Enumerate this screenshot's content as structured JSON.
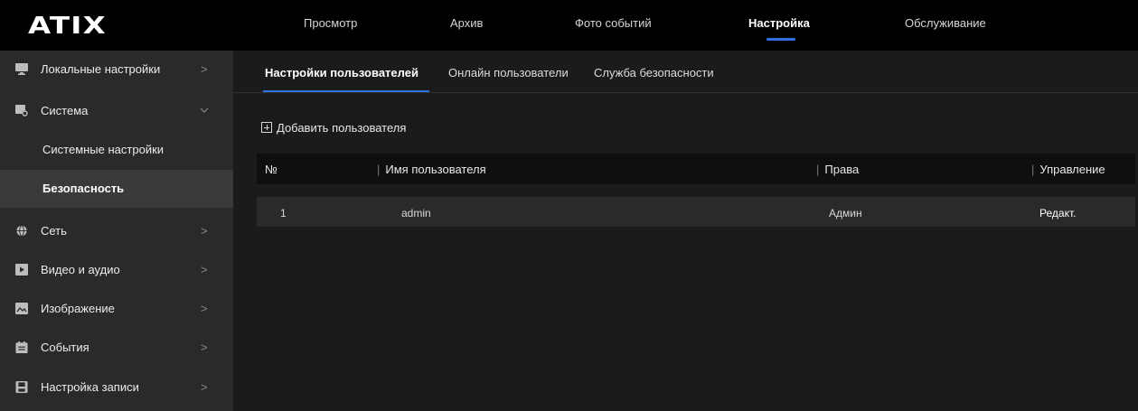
{
  "header": {
    "logo": "ATIX",
    "nav": [
      {
        "label": "Просмотр"
      },
      {
        "label": "Архив"
      },
      {
        "label": "Фото событий"
      },
      {
        "label": "Настройка",
        "active": true
      },
      {
        "label": "Обслуживание"
      }
    ]
  },
  "sidebar": {
    "items": [
      {
        "label": "Локальные настройки",
        "icon": "monitor-icon"
      },
      {
        "label": "Система",
        "icon": "system-settings-icon",
        "expanded": true
      },
      {
        "label": "Системные настройки",
        "sub": true
      },
      {
        "label": "Безопасность",
        "sub": true,
        "active": true
      },
      {
        "label": "Сеть",
        "icon": "network-globe-icon"
      },
      {
        "label": "Видео и аудио",
        "icon": "video-icon"
      },
      {
        "label": "Изображение",
        "icon": "image-icon"
      },
      {
        "label": "События",
        "icon": "calendar-icon"
      },
      {
        "label": "Настройка записи",
        "icon": "save-record-icon"
      }
    ]
  },
  "main": {
    "tabs": [
      {
        "label": "Настройки пользователей",
        "active": true
      },
      {
        "label": "Онлайн пользователи"
      },
      {
        "label": "Служба безопасности"
      }
    ],
    "add_user_label": "Добавить пользователя",
    "table": {
      "columns": [
        "№",
        "Имя пользователя",
        "Права",
        "Управление"
      ],
      "rows": [
        {
          "num": "1",
          "username": "admin",
          "rights": "Админ",
          "action": "Редакт."
        }
      ]
    }
  },
  "colors": {
    "accent": "#2f6fe0",
    "topbar": "#000000",
    "sidebar": "#2a2a2a",
    "background": "#1b1b1b"
  }
}
